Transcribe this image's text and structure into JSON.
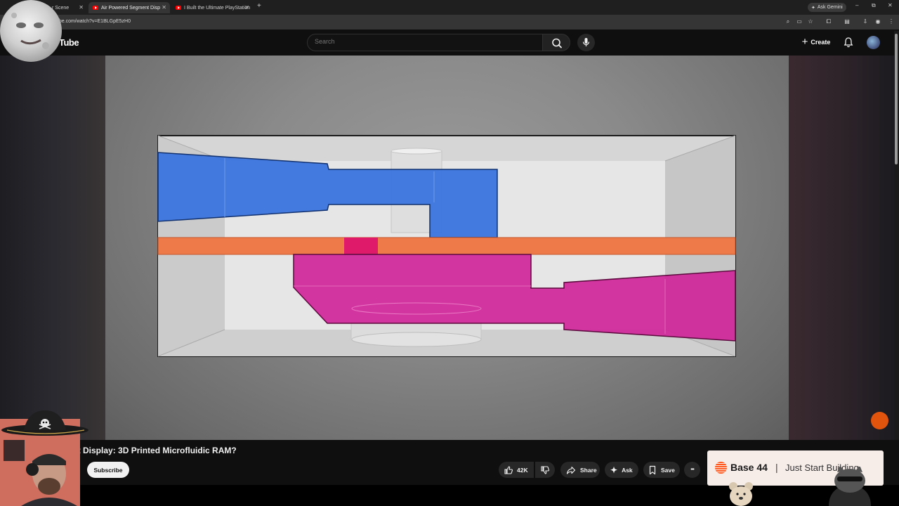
{
  "browser": {
    "tabs": [
      {
        "title": "r Scene",
        "active": false
      },
      {
        "title": "Air Powered Segment Disp",
        "active": true
      },
      {
        "title": "I Built the Ultimate PlayStation",
        "active": false
      }
    ],
    "new_tab": "+",
    "ask_gemini": "Ask Gemini",
    "url": "tube.com/watch?v=E1BLGpE5zH0",
    "window_controls": {
      "minimize": "–",
      "restore": "⧉",
      "close": "✕"
    }
  },
  "youtube": {
    "logo_text": "Tube",
    "search_placeholder": "Search",
    "create_label": "Create",
    "icons": {
      "search": "search-icon",
      "mic": "mic-icon",
      "bell": "bell-icon",
      "plus": "plus-icon"
    }
  },
  "video": {
    "title": "ment Display: 3D Printed Microfluidic RAM?",
    "subscribe_label": "Subscribe",
    "likes": "42K",
    "share_label": "Share",
    "ask_label": "Ask",
    "save_label": "Save",
    "more_label": "•••"
  },
  "ad": {
    "brand": "Base 44",
    "separator": "|",
    "tagline": "Just Start Building"
  },
  "colors": {
    "blue_channel": "#3a74df",
    "orange_bar": "#ee7a4a",
    "magenta_channel": "#d1279a",
    "subscribe_bg": "#f1f1f1",
    "accent_orange": "#e0540e"
  }
}
